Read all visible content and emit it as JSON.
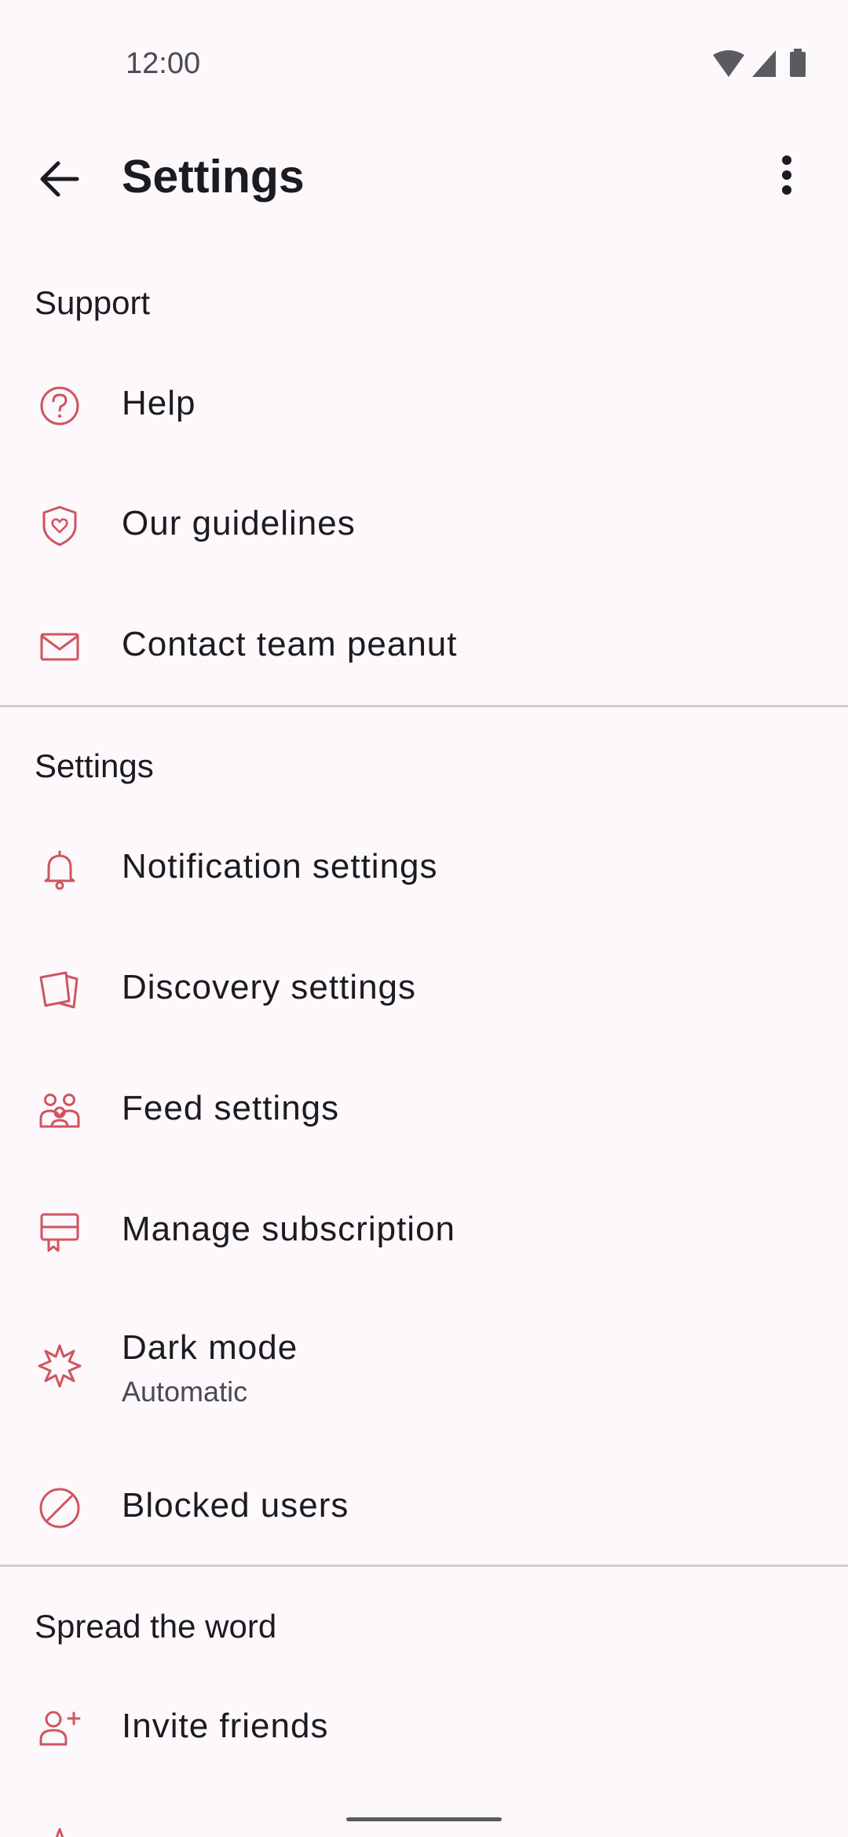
{
  "status_bar": {
    "time": "12:00"
  },
  "app_bar": {
    "title": "Settings"
  },
  "sections": {
    "support": {
      "header": "Support",
      "items": [
        {
          "label": "Help",
          "icon": "help-circle-icon"
        },
        {
          "label": "Our guidelines",
          "icon": "shield-heart-icon"
        },
        {
          "label": "Contact team peanut",
          "icon": "mail-icon"
        }
      ]
    },
    "settings": {
      "header": "Settings",
      "items": [
        {
          "label": "Notification settings",
          "icon": "bell-icon"
        },
        {
          "label": "Discovery settings",
          "icon": "cards-icon"
        },
        {
          "label": "Feed settings",
          "icon": "group-icon"
        },
        {
          "label": "Manage subscription",
          "icon": "subscription-icon"
        },
        {
          "label": "Dark mode",
          "sublabel": "Automatic",
          "icon": "sunburst-icon"
        },
        {
          "label": "Blocked users",
          "icon": "block-icon"
        }
      ]
    },
    "spread": {
      "header": "Spread the word",
      "items": [
        {
          "label": "Invite friends",
          "icon": "add-person-icon"
        }
      ]
    }
  },
  "colors": {
    "accent": "#d0555f",
    "background": "#fcf8fc",
    "text": "#1c1b1f",
    "divider": "#cfcdd2"
  }
}
